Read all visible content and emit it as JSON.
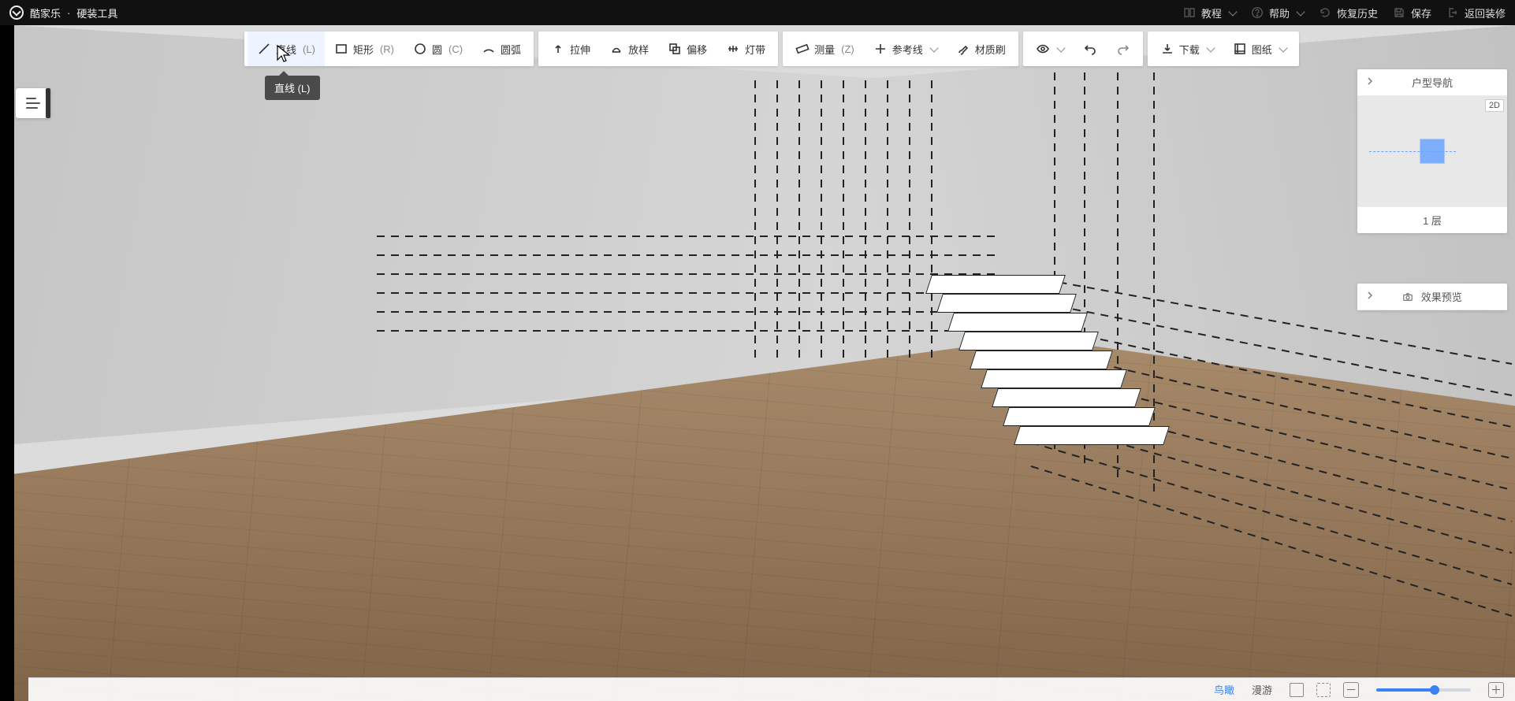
{
  "app": {
    "brand": "酷家乐",
    "module": "硬装工具"
  },
  "topnav": {
    "tutorial": "教程",
    "help": "帮助",
    "history": "恢复历史",
    "save": "保存",
    "back": "返回装修"
  },
  "toolbar": {
    "line": {
      "label": "直线",
      "shortcut": "(L)"
    },
    "rect": {
      "label": "矩形",
      "shortcut": "(R)"
    },
    "circle": {
      "label": "圆",
      "shortcut": "(C)"
    },
    "arc": {
      "label": "圆弧",
      "shortcut": ""
    },
    "extrude": {
      "label": "拉伸",
      "shortcut": ""
    },
    "loft": {
      "label": "放样",
      "shortcut": ""
    },
    "offset": {
      "label": "偏移",
      "shortcut": ""
    },
    "light": {
      "label": "灯带",
      "shortcut": ""
    },
    "measure": {
      "label": "测量",
      "shortcut": "(Z)"
    },
    "refline": {
      "label": "参考线",
      "shortcut": ""
    },
    "matbrush": {
      "label": "材质刷",
      "shortcut": ""
    },
    "download": {
      "label": "下载",
      "shortcut": ""
    },
    "drawing": {
      "label": "图纸",
      "shortcut": ""
    }
  },
  "tooltip": {
    "line": "直线 (L)"
  },
  "rightpanel": {
    "nav_title": "户型导航",
    "floor_label": "1 层",
    "minimap_mode": "2D",
    "preview_title": "效果预览"
  },
  "statusbar": {
    "mode_bird": "鸟瞰",
    "mode_walk": "漫游",
    "zoom_percent": 62
  },
  "colors": {
    "accent": "#3b82f6"
  }
}
